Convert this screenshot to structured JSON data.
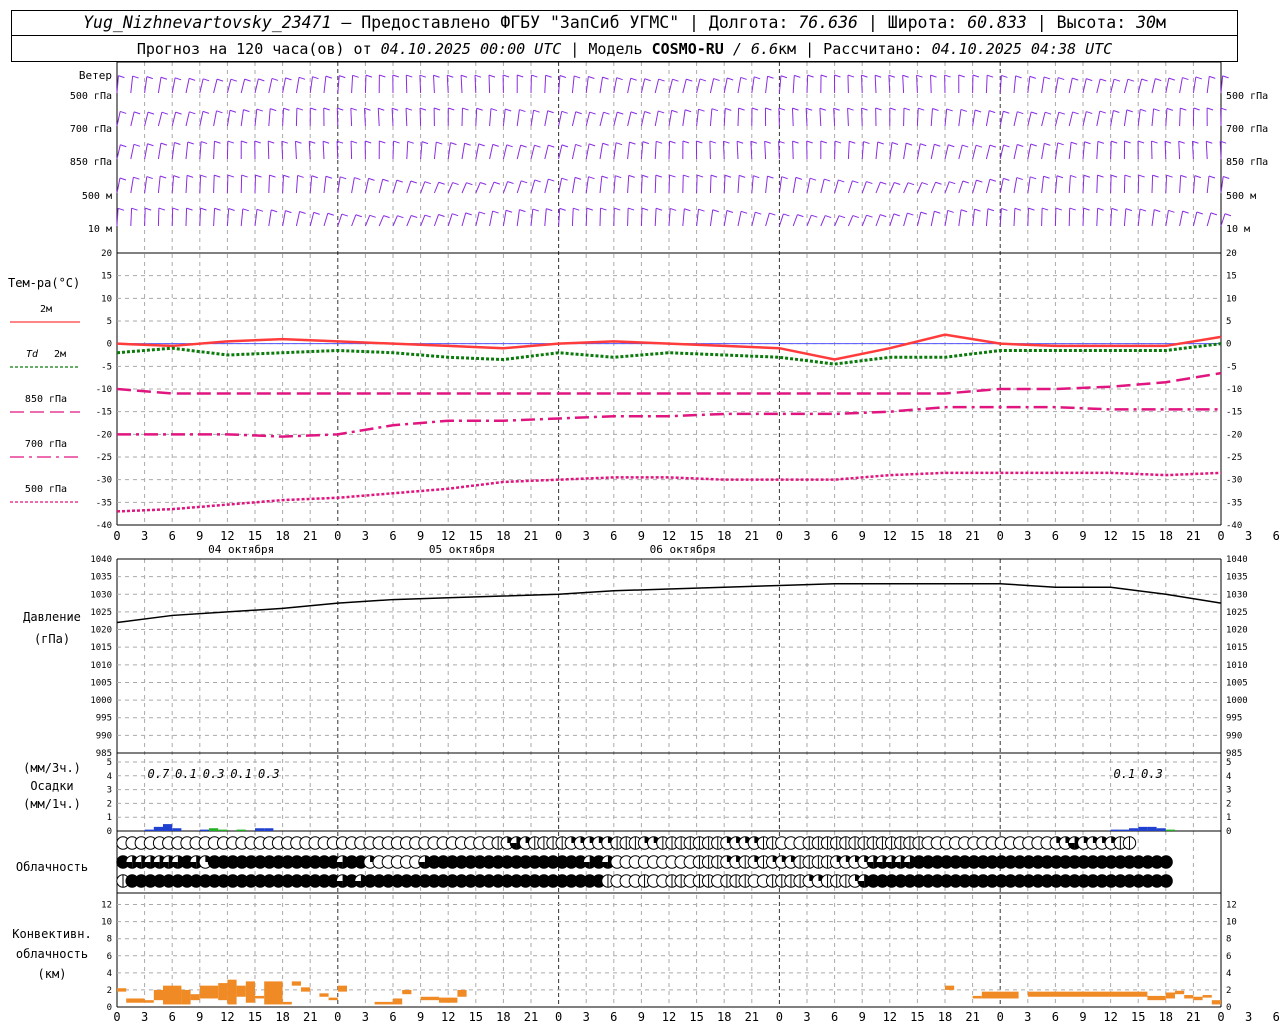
{
  "header": {
    "station": "Yug_Nizhnevartovsky_23471",
    "provider": " – Предоставлено ФГБУ \"ЗапСиб УГМС\" | Долгота: ",
    "lon": "76.636",
    "lat_label": " | Широта: ",
    "lat": "60.833",
    "alt_label": " | Высота: ",
    "alt": "30",
    "alt_unit": "м",
    "forecast_prefix": "Прогноз на 120 часа(ов) от ",
    "forecast_start": "04.10.2025 00:00 UTC",
    "model_label": " | Модель ",
    "model": "COSMO-RU",
    "resolution": " / 6.6",
    "res_unit": "км",
    "calc_label": " | Рассчитано: ",
    "calc_time": "04.10.2025 04:38 UTC"
  },
  "colors": {
    "wind": "#8a2be2",
    "t2m": "#ff3b3b",
    "td2m": "#0a7a0a",
    "magenta": "#e0157f",
    "pressure": "#000000",
    "precip_blue": "#2040d0",
    "precip_green": "#20b020",
    "conv": "#f08a24",
    "grid": "#aaaaaa"
  },
  "chart_data": [
    {
      "type": "wind_barbs",
      "rows": [
        "500 гПа",
        "700 гПа",
        "850 гПа",
        "500 м",
        "10 м"
      ],
      "title_label": "Ветер"
    },
    {
      "type": "line",
      "ylabel": "Тем-ра(°С)",
      "ylim": [
        -40,
        20
      ],
      "yticks": [
        -40,
        -35,
        -30,
        -25,
        -20,
        -15,
        -10,
        -5,
        0,
        5,
        10,
        15,
        20
      ],
      "x_hours": [
        0,
        6,
        12,
        18,
        24,
        30,
        36,
        42,
        48,
        54,
        60,
        66,
        72,
        78,
        84,
        90,
        96,
        102,
        108,
        114,
        120
      ],
      "series": [
        {
          "name": "2м",
          "legend_label": "2м",
          "style": "solid",
          "color_key": "t2m",
          "values": [
            0,
            -0.5,
            0.5,
            1.0,
            0.5,
            0,
            -0.5,
            -1,
            0,
            0.5,
            0,
            -0.5,
            -1,
            -3.5,
            -1,
            2,
            0,
            -0.5,
            -0.5,
            -0.5,
            1.5
          ]
        },
        {
          "name": "Td 2м",
          "legend_label": "2м",
          "legend_italic": "Td",
          "style": "dotted",
          "color_key": "td2m",
          "values": [
            -2,
            -1,
            -2.5,
            -2,
            -1.5,
            -2,
            -3,
            -3.5,
            -2,
            -3,
            -2,
            -2.5,
            -3,
            -4.5,
            -3,
            -3,
            -1.5,
            -1.5,
            -1.5,
            -1.5,
            0
          ]
        },
        {
          "name": "850 гПа",
          "legend_label": "850 гПа",
          "style": "dashed",
          "color_key": "magenta",
          "values": [
            -10,
            -11,
            -11,
            -11,
            -11,
            -11,
            -11,
            -11,
            -11,
            -11,
            -11,
            -11,
            -11,
            -11,
            -11,
            -11,
            -10,
            -10,
            -9.5,
            -8.5,
            -6.5
          ]
        },
        {
          "name": "700 гПа",
          "legend_label": "700 гПа",
          "style": "dashdot",
          "color_key": "magenta",
          "values": [
            -20,
            -20,
            -20,
            -20.5,
            -20,
            -18,
            -17,
            -17,
            -16.5,
            -16,
            -16,
            -15.5,
            -15.5,
            -15.5,
            -15,
            -14,
            -14,
            -14,
            -14.5,
            -14.5,
            -14.5
          ]
        },
        {
          "name": "500 гПа",
          "legend_label": "500 гПа",
          "style": "fine",
          "color_key": "magenta",
          "values": [
            -37,
            -36.5,
            -35.5,
            -34.5,
            -34,
            -33,
            -32,
            -30.5,
            -30,
            -29.5,
            -29.5,
            -30,
            -30,
            -30,
            -29,
            -28.5,
            -28.5,
            -28.5,
            -28.5,
            -29,
            -28.5
          ]
        }
      ]
    },
    {
      "type": "line",
      "ylabel": "Давление",
      "ylabel_unit": "(гПа)",
      "ylim": [
        985,
        1040
      ],
      "yticks": [
        985,
        990,
        995,
        1000,
        1005,
        1010,
        1015,
        1020,
        1025,
        1030,
        1035,
        1040
      ],
      "x_hours": [
        0,
        6,
        12,
        18,
        24,
        30,
        36,
        42,
        48,
        54,
        60,
        66,
        72,
        78,
        84,
        90,
        96,
        102,
        108,
        114,
        120
      ],
      "series": [
        {
          "name": "Давление",
          "values": [
            1022,
            1024,
            1025,
            1026,
            1027.5,
            1028.5,
            1029,
            1029.5,
            1030,
            1031,
            1031.5,
            1032,
            1032.5,
            1033,
            1033,
            1033,
            1033,
            1032,
            1032,
            1030,
            1027.5
          ]
        }
      ]
    },
    {
      "type": "bar",
      "ylabel_top": "(мм/3ч.)",
      "ylabel": "Осадки",
      "ylabel_bottom": "(мм/1ч.)",
      "ylim": [
        0,
        5
      ],
      "yticks": [
        0,
        1,
        2,
        3,
        4,
        5
      ],
      "labels_3h": [
        {
          "x_hour": 4.5,
          "text": "0.7"
        },
        {
          "x_hour": 7.5,
          "text": "0.1"
        },
        {
          "x_hour": 10.5,
          "text": "0.3"
        },
        {
          "x_hour": 13.5,
          "text": "0.1"
        },
        {
          "x_hour": 16.5,
          "text": "0.3"
        },
        {
          "x_hour": 109.5,
          "text": "0.1"
        },
        {
          "x_hour": 112.5,
          "text": "0.3"
        }
      ],
      "bars_1h": [
        {
          "h": 3,
          "v": 0.1,
          "c": "precip_blue"
        },
        {
          "h": 4,
          "v": 0.3,
          "c": "precip_blue"
        },
        {
          "h": 5,
          "v": 0.5,
          "c": "precip_blue"
        },
        {
          "h": 6,
          "v": 0.2,
          "c": "precip_blue"
        },
        {
          "h": 9,
          "v": 0.1,
          "c": "precip_blue"
        },
        {
          "h": 10,
          "v": 0.2,
          "c": "precip_green"
        },
        {
          "h": 11,
          "v": 0.1,
          "c": "precip_green"
        },
        {
          "h": 13,
          "v": 0.1,
          "c": "precip_green"
        },
        {
          "h": 15,
          "v": 0.2,
          "c": "precip_blue"
        },
        {
          "h": 16,
          "v": 0.2,
          "c": "precip_blue"
        },
        {
          "h": 108,
          "v": 0.1,
          "c": "precip_blue"
        },
        {
          "h": 109,
          "v": 0.1,
          "c": "precip_blue"
        },
        {
          "h": 110,
          "v": 0.2,
          "c": "precip_blue"
        },
        {
          "h": 111,
          "v": 0.3,
          "c": "precip_blue"
        },
        {
          "h": 112,
          "v": 0.3,
          "c": "precip_blue"
        },
        {
          "h": 113,
          "v": 0.2,
          "c": "precip_blue"
        },
        {
          "h": 114,
          "v": 0.1,
          "c": "precip_green"
        }
      ]
    },
    {
      "type": "table",
      "label": "Облачность",
      "levels": [
        "upper",
        "middle",
        "lower"
      ],
      "note": "cloud cover per hour in tenths-of-circle symbols; 0 = clear, 4 = overcast",
      "upper": [
        0,
        0,
        0,
        0,
        0,
        0,
        0,
        0,
        0,
        0,
        0,
        0,
        0,
        0,
        0,
        0,
        0,
        0,
        0,
        0,
        0,
        0,
        0,
        0,
        0,
        0,
        0,
        0,
        0,
        0,
        0,
        0,
        0,
        0,
        0,
        0,
        0,
        0,
        0,
        0,
        0,
        1,
        2,
        3,
        2,
        1,
        1,
        1,
        1,
        2,
        2,
        2,
        2,
        2,
        1,
        1,
        1,
        2,
        2,
        1,
        1,
        1,
        1,
        1,
        1,
        1,
        2,
        2,
        2,
        2,
        1,
        1,
        0,
        0,
        0,
        1,
        1,
        1,
        1,
        1,
        1,
        1,
        1,
        1,
        1,
        1,
        1,
        1,
        0,
        0,
        0,
        0,
        0,
        0,
        0,
        0,
        0,
        0,
        0,
        0,
        0,
        0,
        2,
        2,
        3,
        2,
        2,
        2,
        2,
        1,
        1
      ],
      "middle": [
        4,
        3,
        3,
        3,
        3,
        3,
        3,
        4,
        3,
        2,
        4,
        4,
        4,
        4,
        4,
        4,
        4,
        4,
        4,
        4,
        4,
        4,
        4,
        4,
        3,
        4,
        4,
        2,
        0,
        0,
        0,
        0,
        0,
        3,
        4,
        4,
        4,
        4,
        4,
        4,
        4,
        4,
        4,
        4,
        4,
        4,
        4,
        4,
        4,
        4,
        4,
        3,
        4,
        3,
        0,
        0,
        0,
        0,
        0,
        0,
        0,
        0,
        0,
        1,
        1,
        1,
        2,
        2,
        1,
        2,
        1,
        2,
        2,
        2,
        1,
        1,
        1,
        1,
        2,
        2,
        2,
        2,
        3,
        3,
        3,
        3,
        3,
        4,
        4,
        4,
        4,
        4,
        4,
        4,
        4,
        4,
        4,
        4,
        4,
        4,
        4,
        4,
        4,
        4,
        4,
        4,
        4,
        4,
        4,
        4,
        4,
        4,
        4,
        4,
        4
      ],
      "lower": [
        1,
        4,
        4,
        4,
        4,
        4,
        4,
        4,
        4,
        4,
        4,
        4,
        4,
        4,
        4,
        4,
        4,
        4,
        4,
        4,
        4,
        4,
        4,
        4,
        3,
        4,
        3,
        4,
        4,
        4,
        4,
        4,
        4,
        4,
        4,
        4,
        4,
        4,
        4,
        4,
        4,
        4,
        4,
        4,
        4,
        4,
        4,
        4,
        4,
        4,
        4,
        4,
        4,
        1,
        0,
        0,
        0,
        1,
        0,
        0,
        1,
        1,
        0,
        1,
        1,
        0,
        1,
        1,
        1,
        0,
        0,
        1,
        1,
        1,
        1,
        2,
        2,
        1,
        1,
        1,
        2,
        3,
        4,
        4,
        4,
        4,
        4,
        4,
        4,
        4,
        4,
        4,
        4,
        4,
        4,
        4,
        4,
        4,
        4,
        4,
        4,
        4,
        4,
        4,
        4,
        4,
        4,
        4,
        4,
        4,
        4,
        4,
        4,
        4,
        4
      ]
    },
    {
      "type": "bar",
      "ylabel": "Конвективн.",
      "ylabel_2": "облачность",
      "ylabel_3": "(км)",
      "ylim": [
        0,
        13
      ],
      "yticks": [
        0,
        2,
        4,
        6,
        8,
        10,
        12
      ],
      "segments": [
        {
          "h0": 0,
          "h1": 1,
          "b": 1.8,
          "t": 2.2
        },
        {
          "h0": 1,
          "h1": 3,
          "b": 0.5,
          "t": 1.0
        },
        {
          "h0": 3,
          "h1": 4,
          "b": 0.5,
          "t": 0.8
        },
        {
          "h0": 4,
          "h1": 5,
          "b": 0.8,
          "t": 2.0
        },
        {
          "h0": 5,
          "h1": 7,
          "b": 0.3,
          "t": 2.5
        },
        {
          "h0": 7,
          "h1": 8,
          "b": 0.3,
          "t": 2.0
        },
        {
          "h0": 8,
          "h1": 9,
          "b": 0.8,
          "t": 1.5
        },
        {
          "h0": 9,
          "h1": 11,
          "b": 1.0,
          "t": 2.5
        },
        {
          "h0": 11,
          "h1": 12,
          "b": 0.8,
          "t": 2.8
        },
        {
          "h0": 12,
          "h1": 13,
          "b": 0.3,
          "t": 3.2
        },
        {
          "h0": 13,
          "h1": 14,
          "b": 1.2,
          "t": 2.5
        },
        {
          "h0": 14,
          "h1": 15,
          "b": 0.5,
          "t": 3.0
        },
        {
          "h0": 15,
          "h1": 16,
          "b": 1.0,
          "t": 1.3
        },
        {
          "h0": 16,
          "h1": 18,
          "b": 0.3,
          "t": 3.0
        },
        {
          "h0": 18,
          "h1": 19,
          "b": 0.3,
          "t": 0.6
        },
        {
          "h0": 19,
          "h1": 20,
          "b": 2.5,
          "t": 3.0
        },
        {
          "h0": 20,
          "h1": 21,
          "b": 1.8,
          "t": 2.3
        },
        {
          "h0": 22,
          "h1": 23,
          "b": 1.2,
          "t": 1.6
        },
        {
          "h0": 23,
          "h1": 24,
          "b": 0.8,
          "t": 1.1
        },
        {
          "h0": 24,
          "h1": 25,
          "b": 1.8,
          "t": 2.5
        },
        {
          "h0": 28,
          "h1": 30,
          "b": 0.3,
          "t": 0.6
        },
        {
          "h0": 30,
          "h1": 31,
          "b": 0.3,
          "t": 1.0
        },
        {
          "h0": 31,
          "h1": 32,
          "b": 1.5,
          "t": 2.0
        },
        {
          "h0": 33,
          "h1": 35,
          "b": 0.8,
          "t": 1.2
        },
        {
          "h0": 35,
          "h1": 37,
          "b": 0.5,
          "t": 1.1
        },
        {
          "h0": 37,
          "h1": 38,
          "b": 1.2,
          "t": 2.0
        },
        {
          "h0": 90,
          "h1": 91,
          "b": 2.0,
          "t": 2.5
        },
        {
          "h0": 93,
          "h1": 94,
          "b": 1.0,
          "t": 1.3
        },
        {
          "h0": 94,
          "h1": 98,
          "b": 1.0,
          "t": 1.8
        },
        {
          "h0": 99,
          "h1": 112,
          "b": 1.2,
          "t": 1.8
        },
        {
          "h0": 112,
          "h1": 114,
          "b": 0.8,
          "t": 1.3
        },
        {
          "h0": 114,
          "h1": 115,
          "b": 1.0,
          "t": 1.7
        },
        {
          "h0": 115,
          "h1": 116,
          "b": 1.5,
          "t": 1.9
        },
        {
          "h0": 116,
          "h1": 117,
          "b": 1.0,
          "t": 1.4
        },
        {
          "h0": 117,
          "h1": 118,
          "b": 0.8,
          "t": 1.2
        },
        {
          "h0": 118,
          "h1": 119,
          "b": 1.1,
          "t": 1.4
        },
        {
          "h0": 119,
          "h1": 120,
          "b": 0.3,
          "t": 0.8
        }
      ]
    }
  ],
  "axis": {
    "hour_labels": [
      "0",
      "3",
      "6",
      "9",
      "12",
      "15",
      "18",
      "21",
      "0",
      "3",
      "6",
      "9",
      "12",
      "15",
      "18",
      "21",
      "0",
      "3",
      "6",
      "9",
      "12",
      "15",
      "18",
      "21",
      "0",
      "3",
      "6",
      "9",
      "12",
      "15",
      "18",
      "21",
      "0",
      "3",
      "6",
      "9",
      "12",
      "15",
      "18",
      "21",
      "0",
      "3",
      "6"
    ],
    "day_labels": [
      "04 октября",
      "05 октября",
      "06 октября"
    ]
  }
}
